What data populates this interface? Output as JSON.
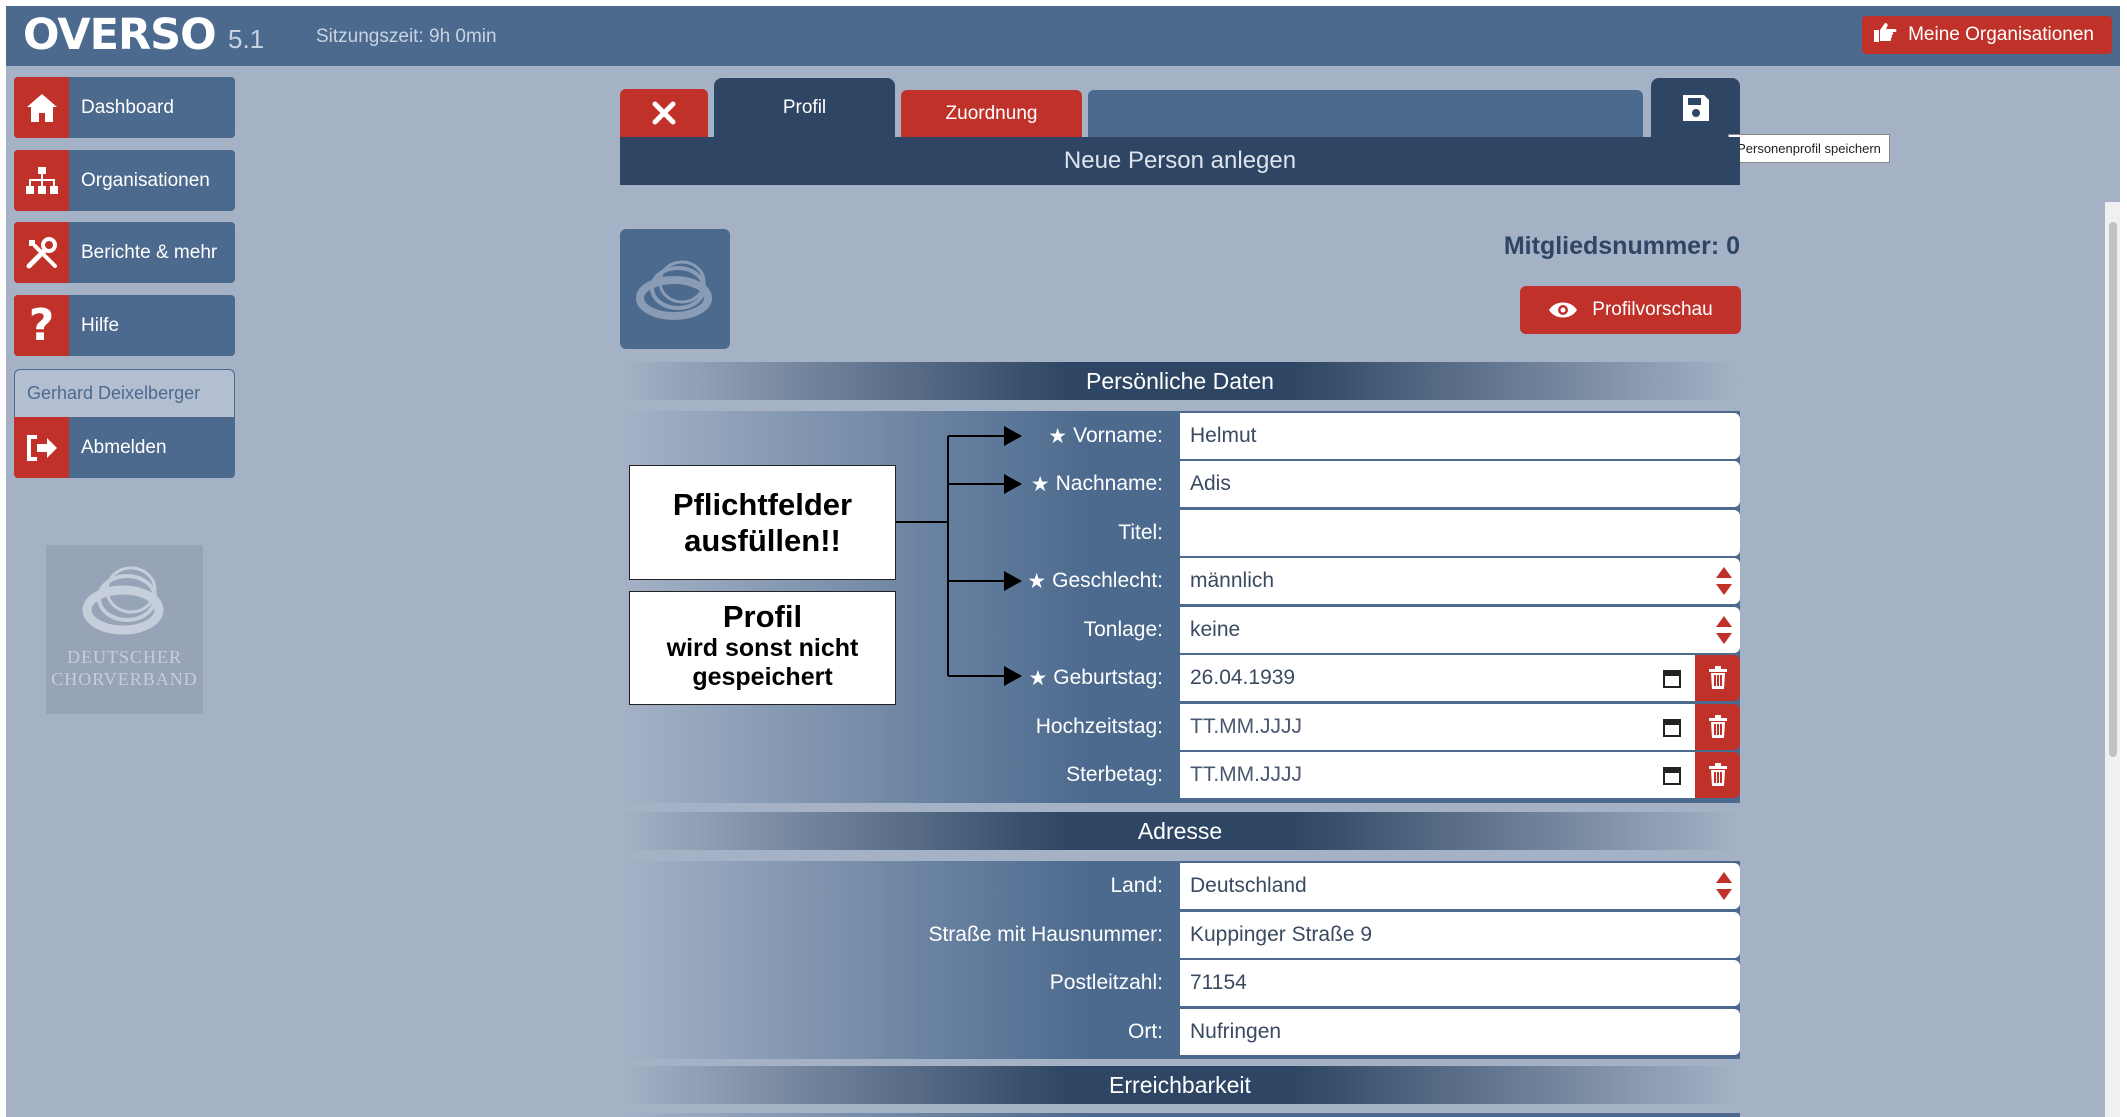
{
  "app": {
    "logo": "OVERSO",
    "version": "5.1",
    "session_time": "Sitzungszeit: 9h 0min",
    "my_orgs_label": "Meine Organisationen"
  },
  "sidebar": {
    "items": [
      {
        "label": "Dashboard",
        "icon": "home-icon"
      },
      {
        "label": "Organisationen",
        "icon": "org-chart-icon"
      },
      {
        "label": "Berichte & mehr",
        "icon": "tools-icon"
      },
      {
        "label": "Hilfe",
        "icon": "question-icon"
      }
    ],
    "user_name": "Gerhard Deixelberger",
    "logout_label": "Abmelden",
    "org_logo_lines": [
      "DEUTSCHER",
      "CHORVERBAND"
    ]
  },
  "tabs": {
    "profil": "Profil",
    "zuordnung": "Zuordnung",
    "save_tooltip": "Personenprofil speichern"
  },
  "page": {
    "title": "Neue Person anlegen",
    "member_number": "Mitgliedsnummer: 0",
    "preview_label": "Profilvorschau"
  },
  "sections": {
    "personal": "Persönliche Daten",
    "address": "Adresse",
    "reachability": "Erreichbarkeit"
  },
  "personal_fields": {
    "vorname": {
      "label": "Vorname:",
      "value": "Helmut",
      "required": true
    },
    "nachname": {
      "label": "Nachname:",
      "value": "Adis",
      "required": true
    },
    "titel": {
      "label": "Titel:",
      "value": ""
    },
    "geschlecht": {
      "label": "Geschlecht:",
      "value": "männlich",
      "required": true
    },
    "tonlage": {
      "label": "Tonlage:",
      "value": "keine"
    },
    "geburtstag": {
      "label": "Geburtstag:",
      "value": "26.04.1939",
      "required": true
    },
    "hochzeitstag": {
      "label": "Hochzeitstag:",
      "value": "TT.MM.JJJJ"
    },
    "sterbetag": {
      "label": "Sterbetag:",
      "value": "TT.MM.JJJJ"
    }
  },
  "address_fields": {
    "land": {
      "label": "Land:",
      "value": "Deutschland"
    },
    "strasse": {
      "label": "Straße mit Hausnummer:",
      "value": "Kuppinger Straße 9"
    },
    "plz": {
      "label": "Postleitzahl:",
      "value": "71154"
    },
    "ort": {
      "label": "Ort:",
      "value": "Nufringen"
    }
  },
  "annotations": {
    "callout1_line1": "Pflichtfelder",
    "callout1_line2": "ausfüllen!!",
    "callout2_line1": "Profil",
    "callout2_line2": "wird sonst nicht",
    "callout2_line3": "gespeichert"
  },
  "colors": {
    "topbar": "#4c6a8e",
    "accent_red": "#c0312a",
    "dark_blue": "#2e4663",
    "background": "#a5b2c6"
  }
}
